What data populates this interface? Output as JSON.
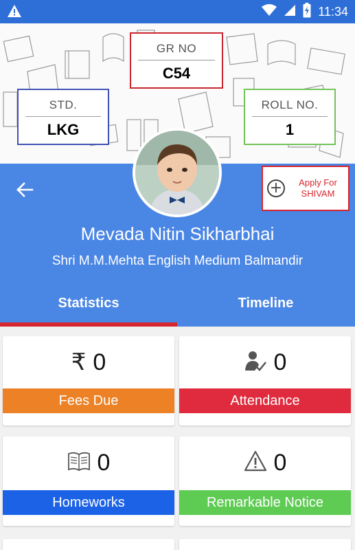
{
  "status_bar": {
    "time": "11:34",
    "icons": [
      "warning-icon",
      "wifi-icon",
      "signal-icon",
      "battery-charging-icon"
    ]
  },
  "header": {
    "gr_no": {
      "label": "GR NO",
      "value": "C54"
    },
    "std": {
      "label": "STD.",
      "value": "LKG"
    },
    "roll_no": {
      "label": "ROLL NO.",
      "value": "1"
    }
  },
  "profile": {
    "student_name": "Mevada Nitin Sikharbhai",
    "school_name": "Shri M.M.Mehta English Medium Balmandir",
    "apply_button_line1": "Apply For",
    "apply_button_line2": "SHIVAM"
  },
  "tabs": [
    {
      "label": "Statistics",
      "active": true
    },
    {
      "label": "Timeline",
      "active": false
    }
  ],
  "stats": [
    {
      "icon": "rupee-icon",
      "count": "0",
      "label": "Fees Due",
      "color": "#ec8126"
    },
    {
      "icon": "attendance-icon",
      "count": "0",
      "label": "Attendance",
      "color": "#df2b3d"
    },
    {
      "icon": "book-icon",
      "count": "0",
      "label": "Homeworks",
      "color": "#1b62e6"
    },
    {
      "icon": "warning-icon",
      "count": "0",
      "label": "Remarkable Notice",
      "color": "#5ecb53"
    }
  ],
  "colors": {
    "status_bar": "#2e6fd7",
    "band": "#4a86e4",
    "accent_red": "#d6252d"
  }
}
